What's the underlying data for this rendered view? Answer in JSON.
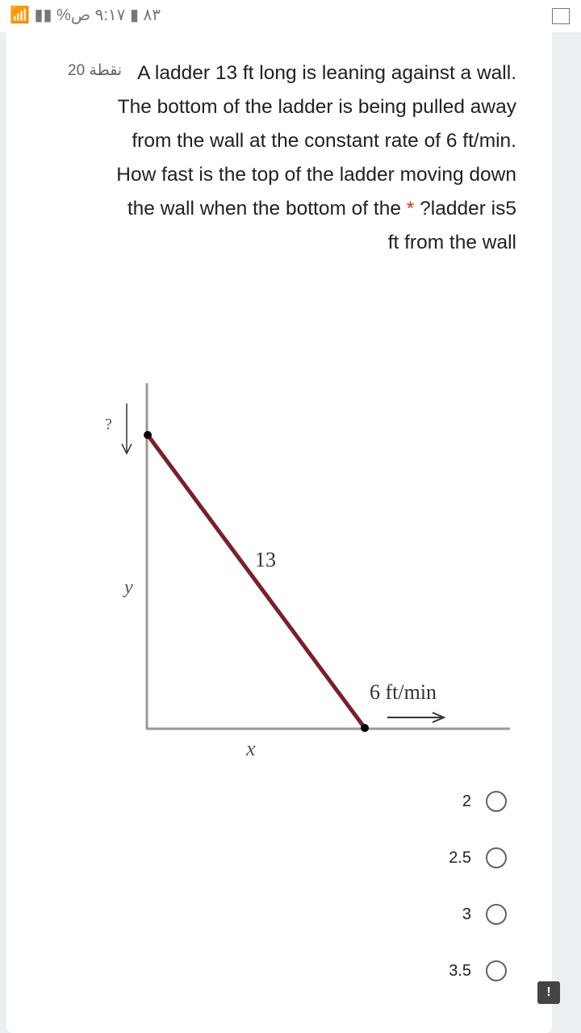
{
  "status_bar": {
    "time": "٩:١٧ ص",
    "battery": "%٨٣"
  },
  "question": {
    "points": "20 نقطة",
    "text": "A ladder 13 ft long is leaning against a wall. The bottom of the ladder is being pulled away from the wall at the constant rate of 6 ft/min. How fast is the top of the ladder moving down the wall when the bottom of the ",
    "text_end": "?ladder is5 ft from the wall",
    "required": "*"
  },
  "diagram": {
    "unknown": "?",
    "ladder_length": "13",
    "y_label": "y",
    "x_label": "x",
    "rate": "6 ft/min",
    "ladder_color": "#7a1f2b"
  },
  "options": [
    {
      "label": "2",
      "selected": false
    },
    {
      "label": "2.5",
      "selected": false
    },
    {
      "label": "3",
      "selected": false
    },
    {
      "label": "3.5",
      "selected": false
    }
  ]
}
